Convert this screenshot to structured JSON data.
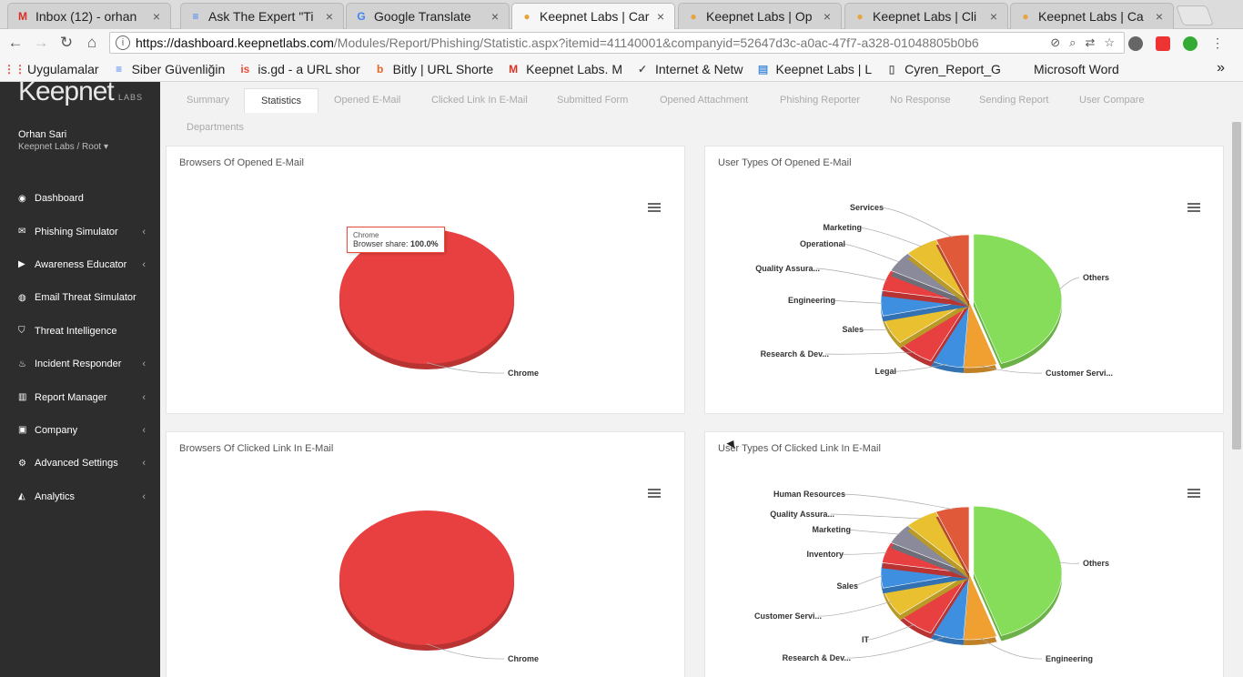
{
  "browser": {
    "tabs": [
      {
        "label": "Inbox (12) - orhan",
        "icon": "gmail-icon",
        "icon_char": "M",
        "icon_color": "#d93025"
      },
      {
        "label": "Ask The Expert \"Ti",
        "icon": "docs-icon",
        "icon_char": "≡",
        "icon_color": "#4285f4"
      },
      {
        "label": "Google Translate",
        "icon": "translate-icon",
        "icon_char": "G",
        "icon_color": "#4285f4"
      },
      {
        "label": "Keepnet Labs | Car",
        "icon": "keepnet-icon",
        "icon_char": "●",
        "icon_color": "#e8a33d",
        "active": true
      },
      {
        "label": "Keepnet Labs | Op",
        "icon": "keepnet-icon",
        "icon_char": "●",
        "icon_color": "#e8a33d"
      },
      {
        "label": "Keepnet Labs | Cli",
        "icon": "keepnet-icon",
        "icon_char": "●",
        "icon_color": "#e8a33d"
      },
      {
        "label": "Keepnet Labs | Ca",
        "icon": "keepnet-icon",
        "icon_char": "●",
        "icon_color": "#e8a33d"
      }
    ],
    "url_host": "https://dashboard.keepnetlabs.com",
    "url_rest": "/Modules/Report/Phishing/Statistic.aspx?itemid=41140001&companyid=52647d3c-a0ac-47f7-a328-01048805b0b6",
    "bookmarks": [
      {
        "label": "Uygulamalar",
        "icon": "apps-icon",
        "icon_char": "⋮⋮",
        "icon_color": "#e74c3c"
      },
      {
        "label": "Siber Güvenliğin",
        "icon": "docs-icon",
        "icon_char": "≡",
        "icon_color": "#4285f4"
      },
      {
        "label": "is.gd - a URL shor",
        "icon": "isgd-icon",
        "icon_char": "is",
        "icon_color": "#e74c3c"
      },
      {
        "label": "Bitly | URL Shorte",
        "icon": "bitly-icon",
        "icon_char": "b",
        "icon_color": "#ee6123"
      },
      {
        "label": "Keepnet Labs. M",
        "icon": "gmail-icon",
        "icon_char": "M",
        "icon_color": "#d93025"
      },
      {
        "label": "Internet & Netw",
        "icon": "check-icon",
        "icon_char": "✓",
        "icon_color": "#555"
      },
      {
        "label": "Keepnet Labs | L",
        "icon": "page-icon",
        "icon_char": "▤",
        "icon_color": "#4a90d9"
      },
      {
        "label": "Cyren_Report_G",
        "icon": "file-icon",
        "icon_char": "▯",
        "icon_color": "#666"
      },
      {
        "label": "Microsoft Word",
        "icon": "word-icon",
        "icon_char": "",
        "icon_color": "#2b579a"
      }
    ]
  },
  "sidebar": {
    "logo_text": "Keepnet",
    "logo_sub": "LABS",
    "user_name": "Orhan Sari",
    "user_org": "Keepnet Labs / Root ▾",
    "items": [
      {
        "label": "Dashboard",
        "icon": "dashboard-icon",
        "glyph": "◉",
        "has_children": false
      },
      {
        "label": "Phishing Simulator",
        "icon": "envelope-icon",
        "glyph": "✉",
        "has_children": true
      },
      {
        "label": "Awareness Educator",
        "icon": "video-icon",
        "glyph": "▶",
        "has_children": true
      },
      {
        "label": "Email Threat Simulator",
        "icon": "globe-icon",
        "glyph": "◍",
        "has_children": false
      },
      {
        "label": "Threat Intelligence",
        "icon": "shield-icon",
        "glyph": "⛉",
        "has_children": false
      },
      {
        "label": "Incident Responder",
        "icon": "fire-icon",
        "glyph": "♨",
        "has_children": true
      },
      {
        "label": "Report Manager",
        "icon": "bar-chart-icon",
        "glyph": "▥",
        "has_children": true
      },
      {
        "label": "Company",
        "icon": "briefcase-icon",
        "glyph": "▣",
        "has_children": true
      },
      {
        "label": "Advanced Settings",
        "icon": "gears-icon",
        "glyph": "⚙",
        "has_children": true
      },
      {
        "label": "Analytics",
        "icon": "area-chart-icon",
        "glyph": "◭",
        "has_children": true
      }
    ]
  },
  "report_tabs": [
    {
      "label": "Summary"
    },
    {
      "label": "Statistics",
      "active": true
    },
    {
      "label": "Opened E-Mail"
    },
    {
      "label": "Clicked Link In E-Mail"
    },
    {
      "label": "Submitted Form"
    },
    {
      "label": "Opened Attachment"
    },
    {
      "label": "Phishing Reporter"
    },
    {
      "label": "No Response"
    },
    {
      "label": "Sending Report"
    },
    {
      "label": "User Compare"
    },
    {
      "label": "Departments"
    }
  ],
  "panels": {
    "browsers_opened": {
      "title": "Browsers Of Opened E-Mail"
    },
    "usertypes_opened": {
      "title": "User Types Of Opened E-Mail"
    },
    "browsers_clicked": {
      "title": "Browsers Of Clicked Link In E-Mail"
    },
    "usertypes_clicked": {
      "title": "User Types Of Clicked Link In E-Mail"
    }
  },
  "tooltip": {
    "title": "Chrome",
    "label": "Browser share:",
    "value": "100.0%"
  },
  "chart_data": [
    {
      "type": "pie",
      "title": "Browsers Of Opened E-Mail",
      "categories": [
        "Chrome"
      ],
      "values": [
        100
      ],
      "colors": [
        "#e84040"
      ]
    },
    {
      "type": "pie",
      "title": "User Types Of Opened E-Mail",
      "categories": [
        "Others",
        "Customer Servi...",
        "Legal",
        "Research & Dev...",
        "Sales",
        "Engineering",
        "Quality Assura...",
        "Operational",
        "Marketing",
        "Services"
      ],
      "values": [
        44,
        6,
        6,
        7,
        7,
        6,
        5,
        5,
        6,
        6
      ],
      "colors": [
        "#86dd5a",
        "#f0a030",
        "#3f8fe0",
        "#e84040",
        "#e8c030",
        "#3f8fe0",
        "#e84040",
        "#8a8a9a",
        "#e8c030",
        "#e05a3a"
      ]
    },
    {
      "type": "pie",
      "title": "Browsers Of Clicked Link In E-Mail",
      "categories": [
        "Chrome"
      ],
      "values": [
        100
      ],
      "colors": [
        "#e84040"
      ]
    },
    {
      "type": "pie",
      "title": "User Types Of Clicked Link In E-Mail",
      "categories": [
        "Others",
        "Engineering",
        "Research & Dev...",
        "IT",
        "Customer Servi...",
        "Sales",
        "Inventory",
        "Marketing",
        "Quality Assura...",
        "Human Resources"
      ],
      "values": [
        44,
        6,
        6,
        7,
        7,
        6,
        5,
        5,
        6,
        6
      ],
      "colors": [
        "#86dd5a",
        "#f0a030",
        "#3f8fe0",
        "#e84040",
        "#e8c030",
        "#3f8fe0",
        "#e84040",
        "#8a8a9a",
        "#e8c030",
        "#e05a3a"
      ]
    }
  ]
}
